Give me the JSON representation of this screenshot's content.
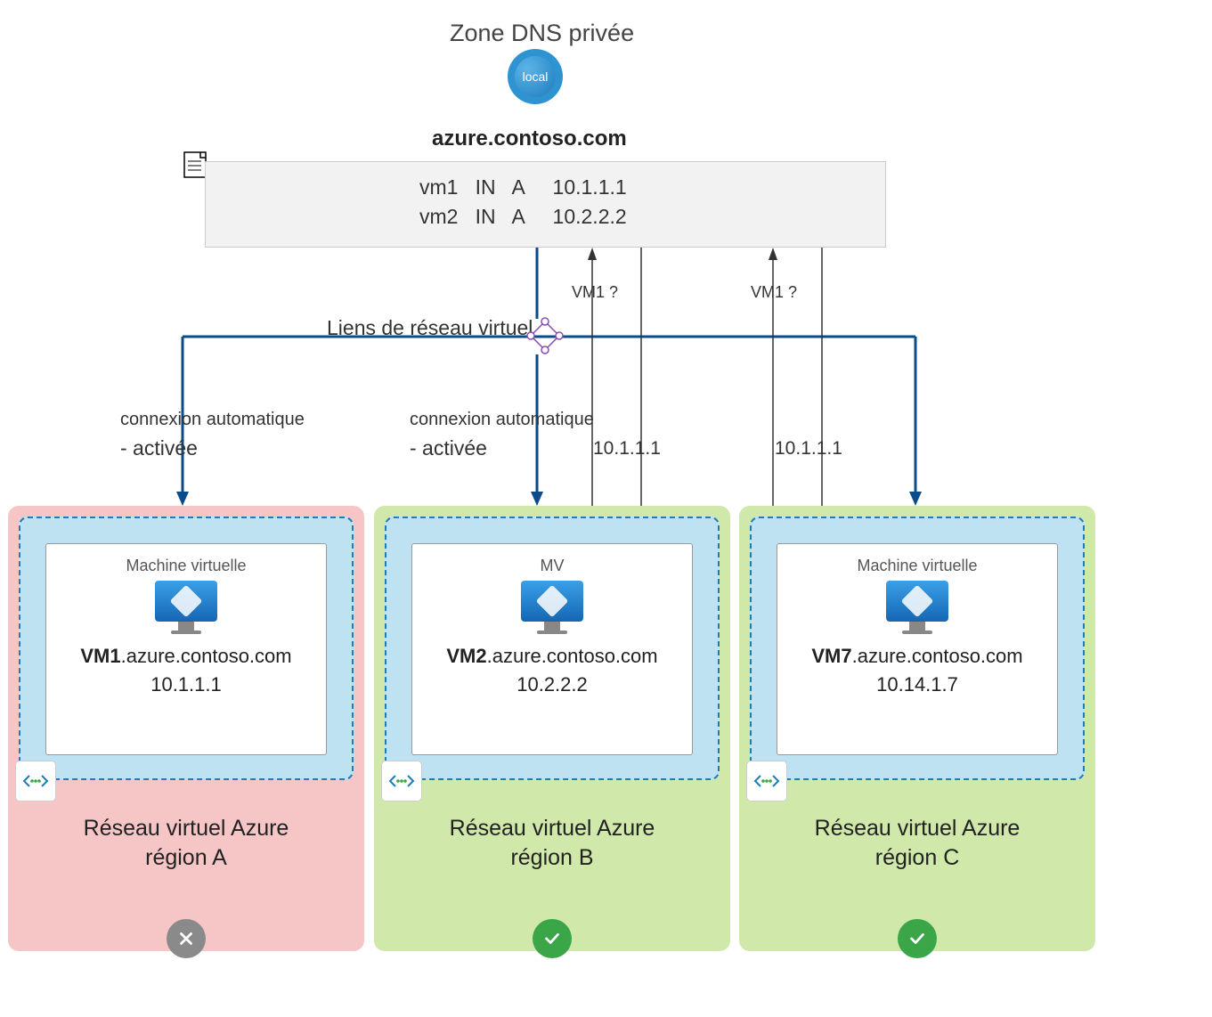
{
  "header": {
    "title": "Zone DNS privée",
    "globe_label": "local",
    "zone_name": "azure.contoso.com"
  },
  "dns_records": {
    "row1": "vm1   IN   A     10.1.1.1",
    "row2": "vm2   IN   A     10.2.2.2"
  },
  "vnet_links_label": "Liens de réseau virtuel",
  "autoreg": {
    "a_title": "connexion automatique",
    "a_status": "- activée",
    "b_title": "connexion automatique",
    "b_status": "- activée"
  },
  "queries": {
    "b_query": "VM1 ?",
    "c_query": "VM1 ?",
    "b_response": "10.1.1.1",
    "c_response": "10.1.1.1"
  },
  "regions": {
    "a": {
      "vm_label": "Machine virtuelle",
      "vm_name": "VM1",
      "vm_domain": ".azure.contoso.com",
      "vm_ip": "10.1.1.1",
      "title": "Réseau virtuel Azure",
      "subtitle": "région A",
      "status": "fail"
    },
    "b": {
      "vm_label": "MV",
      "vm_name": "VM2",
      "vm_domain": ".azure.contoso.com",
      "vm_ip": "10.2.2.2",
      "title": "Réseau virtuel Azure",
      "subtitle": "région B",
      "status": "ok"
    },
    "c": {
      "vm_label": "Machine virtuelle",
      "vm_name": "VM7",
      "vm_domain": ".azure.contoso.com",
      "vm_ip": "10.14.1.7",
      "title": "Réseau virtuel Azure",
      "subtitle": "région C",
      "status": "ok"
    }
  }
}
